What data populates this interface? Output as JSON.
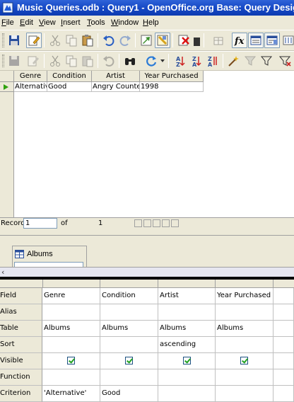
{
  "window": {
    "title": "Music Queries.odb : Query1 - OpenOffice.org Base: Query Design"
  },
  "menu": [
    "File",
    "Edit",
    "View",
    "Insert",
    "Tools",
    "Window",
    "Help"
  ],
  "toolbar1_icons": [
    "save-icon",
    "edit-icon",
    "cut-icon",
    "copy-icon",
    "paste-icon",
    "undo-icon",
    "redo-icon",
    "run-query-icon",
    "switch-design-icon",
    "clear-icon",
    "add-table-icon",
    "functions-icon",
    "table-name-icon",
    "alias-icon",
    "distinct-icon"
  ],
  "toolbar2_icons": [
    "save-icon",
    "edit-icon",
    "cut-icon",
    "copy-icon",
    "paste-icon",
    "undo-icon",
    "find-icon",
    "refresh-icon",
    "sort-ascending-icon",
    "sort-descending-icon",
    "sort-icon",
    "autofilter-icon",
    "filter-icon",
    "standard-filter-icon",
    "remove-filter-icon"
  ],
  "result": {
    "columns": [
      "Genre",
      "Condition",
      "Artist",
      "Year Purchased"
    ],
    "rows": [
      [
        "Alternative",
        "Good",
        "Angry Counter",
        "1998"
      ]
    ]
  },
  "record_bar": {
    "label": "Record",
    "current": "1",
    "of_label": "of",
    "total": "1"
  },
  "table_window": {
    "name": "Albums"
  },
  "design": {
    "row_labels": [
      "Field",
      "Alias",
      "Table",
      "Sort",
      "Visible",
      "Function",
      "Criterion"
    ],
    "columns": [
      {
        "field": "Genre",
        "alias": "",
        "table": "Albums",
        "sort": "",
        "visible": true,
        "function": "",
        "criterion": "'Alternative'"
      },
      {
        "field": "Condition",
        "alias": "",
        "table": "Albums",
        "sort": "",
        "visible": true,
        "function": "",
        "criterion": "Good"
      },
      {
        "field": "Artist",
        "alias": "",
        "table": "Albums",
        "sort": "ascending",
        "visible": true,
        "function": "",
        "criterion": ""
      },
      {
        "field": "Year Purchased",
        "alias": "",
        "table": "Albums",
        "sort": "",
        "visible": true,
        "function": "",
        "criterion": ""
      }
    ]
  }
}
